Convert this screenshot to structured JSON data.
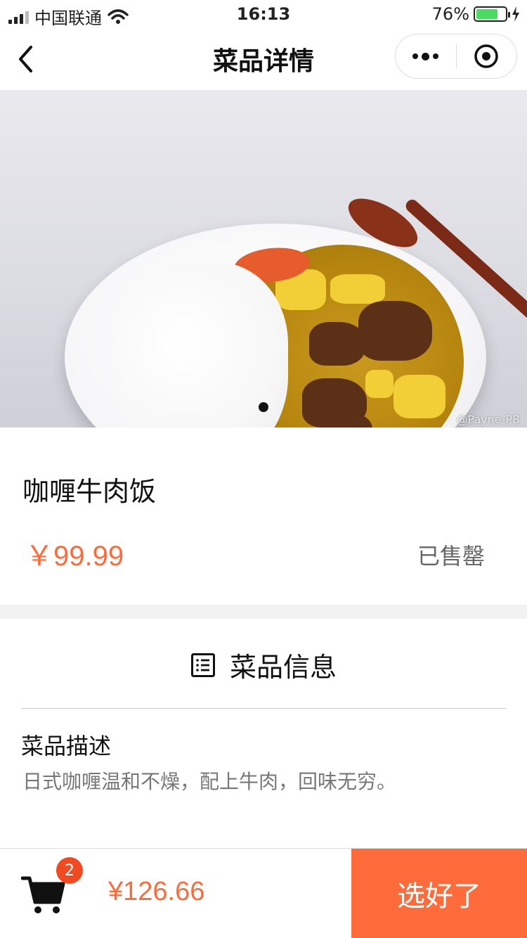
{
  "status_bar": {
    "carrier": "中国联通",
    "time": "16:13",
    "battery": "76%",
    "battery_level": 0.76
  },
  "nav": {
    "title": "菜品详情"
  },
  "hero": {
    "watermark": "@Payne-PB",
    "carousel_dots": 1
  },
  "dish": {
    "name": "咖喱牛肉饭",
    "price": "￥99.99",
    "status": "已售罄"
  },
  "info": {
    "section_title": "菜品信息",
    "description_label": "菜品描述",
    "description": "日式咖喱温和不燥，配上牛肉，回味无穷。"
  },
  "footer": {
    "cart_count": "2",
    "total": "¥126.66",
    "checkout_label": "选好了"
  },
  "colors": {
    "accent": "#ff6b3a",
    "price": "#fb6b3b",
    "badge": "#f04a22"
  }
}
